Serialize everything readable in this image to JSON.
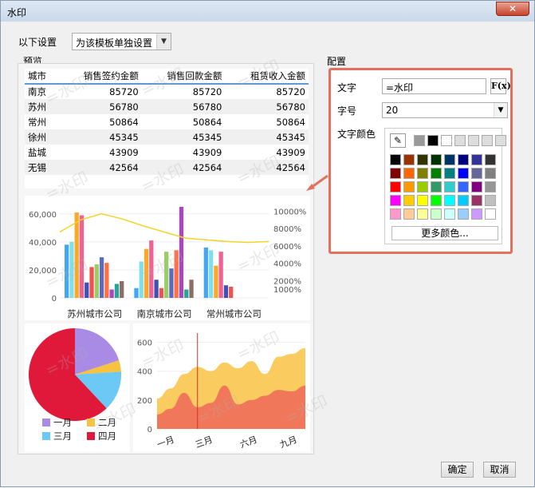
{
  "window": {
    "title": "水印",
    "close_label": "✕"
  },
  "settings": {
    "label": "以下设置",
    "mode_value": "为该模板单独设置"
  },
  "preview": {
    "label": "预览"
  },
  "config": {
    "label": "配置",
    "text_label": "文字",
    "text_value": "=水印",
    "fx_label": "F(x)",
    "fontsize_label": "字号",
    "fontsize_value": "20",
    "color_label": "文字颜色",
    "more_colors": "更多颜色..."
  },
  "buttons": {
    "ok": "确定",
    "cancel": "取消"
  },
  "watermark": {
    "text": "=水印"
  },
  "colors": {
    "highlight_border": "#e2725f",
    "table_header_line": "#5b9bd5"
  },
  "palette": {
    "top": [
      "#999999",
      "#000000",
      "#ffffff",
      "#dddddd",
      "#dddddd",
      "#dddddd",
      "#dddddd"
    ],
    "grid": [
      [
        "#000000",
        "#993300",
        "#333300",
        "#003300",
        "#003366",
        "#000080",
        "#333399",
        "#333333"
      ],
      [
        "#800000",
        "#ff6600",
        "#808000",
        "#008000",
        "#008080",
        "#0000ff",
        "#666699",
        "#808080"
      ],
      [
        "#ff0000",
        "#ff9900",
        "#99cc00",
        "#339966",
        "#33cccc",
        "#3366ff",
        "#800080",
        "#969696"
      ],
      [
        "#ff00ff",
        "#ffcc00",
        "#ffff00",
        "#00ff00",
        "#00ffff",
        "#00ccff",
        "#993366",
        "#c0c0c0"
      ],
      [
        "#ff99cc",
        "#ffcc99",
        "#ffff99",
        "#ccffcc",
        "#ccffff",
        "#99ccff",
        "#cc99ff",
        "#ffffff"
      ]
    ]
  },
  "table": {
    "headers": [
      "城市",
      "销售签约金额",
      "销售回款金额",
      "租赁收入金额"
    ],
    "rows": [
      [
        "南京",
        "85720",
        "85720",
        "85720"
      ],
      [
        "苏州",
        "56780",
        "56780",
        "56780"
      ],
      [
        "常州",
        "50864",
        "50864",
        "50864"
      ],
      [
        "徐州",
        "45345",
        "45345",
        "45345"
      ],
      [
        "盐城",
        "43909",
        "43909",
        "43909"
      ],
      [
        "无锡",
        "42564",
        "42564",
        "42564"
      ]
    ]
  },
  "chart_data": [
    {
      "type": "bar",
      "categories": [
        "苏州城市公司",
        "南京城市公司",
        "常州城市公司"
      ],
      "yticks": [
        "60,000",
        "40,000",
        "20,000",
        "0"
      ],
      "y2ticks": [
        "10000%",
        "8000%",
        "6000%",
        "4000%",
        "2000%",
        "1000%"
      ],
      "ylim": [
        0,
        65000
      ],
      "y2lim": [
        0,
        10500
      ],
      "bar_colors": [
        "#42a5f5",
        "#80deea",
        "#ffa726",
        "#f06292",
        "#3f51b5",
        "#ef5350",
        "#9ccc65",
        "#5c6bc0",
        "#ff7043",
        "#ab47bc",
        "#26a69a",
        "#8d6e63"
      ],
      "groups": [
        [
          38000,
          40000,
          61000,
          59000,
          11000,
          22000,
          24000,
          29000,
          25000,
          6000,
          10000,
          12000
        ],
        [
          7000,
          26000,
          35000,
          41000,
          13000,
          7000,
          33000,
          21000,
          34000,
          65000,
          6000,
          13000
        ],
        [
          36000,
          34000,
          23000,
          33000,
          9000,
          8000,
          0,
          0,
          0,
          0,
          0,
          0
        ]
      ],
      "line_series": [
        7600,
        9000,
        9700,
        9100,
        8300,
        7600,
        6900,
        6700,
        6500,
        6400,
        6500
      ],
      "line_color": "#f5d327"
    },
    {
      "type": "pie",
      "slices": [
        {
          "name": "一月",
          "value": 20,
          "color": "#a98be6"
        },
        {
          "name": "二月",
          "value": 4,
          "color": "#f5c242"
        },
        {
          "name": "三月",
          "value": 14,
          "color": "#6cc9f5"
        },
        {
          "name": "四月",
          "value": 62,
          "color": "#e0183a"
        }
      ]
    },
    {
      "type": "area",
      "categories": [
        "一月",
        "三月",
        "六月",
        "九月"
      ],
      "yticks": [
        "600",
        "400",
        "200",
        "0"
      ],
      "ylim": [
        0,
        620
      ],
      "series": [
        {
          "values": [
            210,
            280,
            380,
            430,
            400,
            460,
            420,
            470,
            380,
            500,
            520,
            560
          ],
          "color": "#f9c74f"
        },
        {
          "values": [
            100,
            140,
            250,
            150,
            180,
            300,
            170,
            200,
            230,
            270,
            260,
            300
          ],
          "color": "#ef6e5a"
        }
      ],
      "marker_index": 3,
      "marker_color": "#d73027"
    }
  ]
}
